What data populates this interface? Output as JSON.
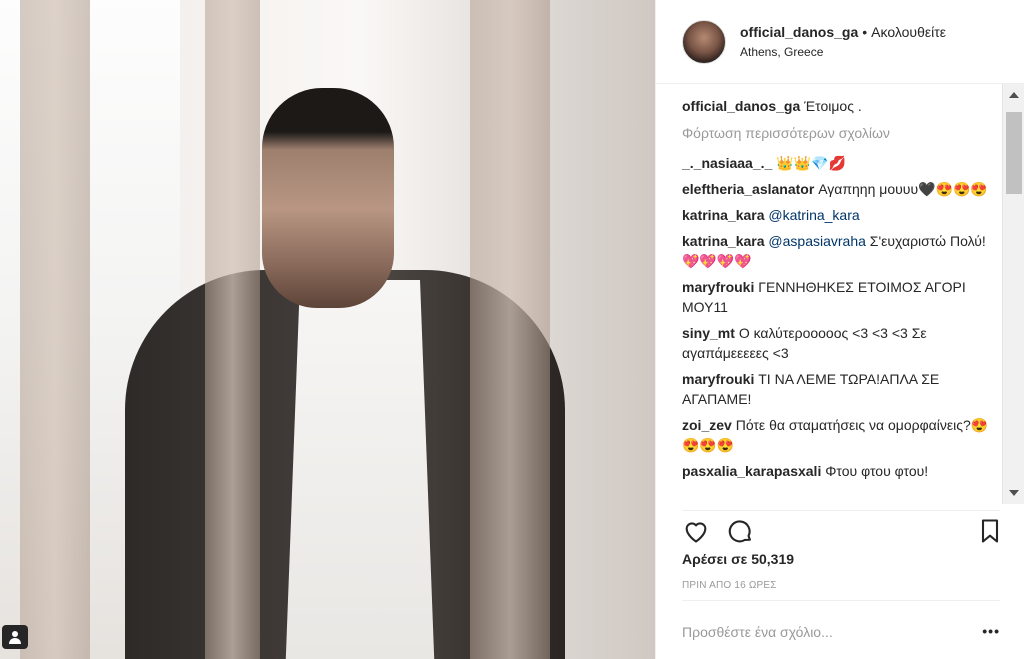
{
  "header": {
    "username": "official_danos_ga",
    "separator": "•",
    "follow_label": "Ακολουθείτε",
    "location": "Athens, Greece"
  },
  "caption": {
    "username": "official_danos_ga",
    "text": "Έτοιμος ."
  },
  "load_more": "Φόρτωση περισσότερων σχολίων",
  "comments": [
    {
      "user": "_._nasiaaa_._",
      "text": "👑👑💎💋"
    },
    {
      "user": "eleftheria_aslanator",
      "text": "Αγαπηηη μουυυ🖤😍😍😍"
    },
    {
      "user": "katrina_kara",
      "mention": "@katrina_kara",
      "text": ""
    },
    {
      "user": "katrina_kara",
      "mention": "@aspasiavraha",
      "text": "Σ'ευχαριστώ Πολύ!💖💖💖💖"
    },
    {
      "user": "maryfrouki",
      "text": "ΓΕΝΝΗΘΗΚΕΣ ΕΤΟΙΜΟΣ ΑΓΟΡΙ ΜΟΥ11"
    },
    {
      "user": "siny_mt",
      "text": "Ο καλύτεροοοοος <3 <3 <3 Σε αγαπάμεεεεες <3"
    },
    {
      "user": "maryfrouki",
      "text": "ΤΙ ΝΑ ΛΕΜΕ ΤΩΡΑ!ΑΠΛΑ ΣΕ ΑΓΑΠΑΜΕ!"
    },
    {
      "user": "zoi_zev",
      "text": "Πότε θα σταματήσεις να ομορφαίνεις?😍😍😍😍"
    },
    {
      "user": "pasxalia_karapasxali",
      "text": "Φτου φτου φτου!"
    }
  ],
  "likes": "Αρέσει σε 50,319",
  "timestamp": "ΠΡΙΝ ΑΠΟ 16 ΩΡΕΣ",
  "add_comment": {
    "placeholder": "Προσθέστε ένα σχόλιο...",
    "more": "•••"
  },
  "icons": {
    "like": "heart-icon",
    "comment": "comment-icon",
    "save": "bookmark-icon",
    "tagged": "user-tag-icon"
  }
}
